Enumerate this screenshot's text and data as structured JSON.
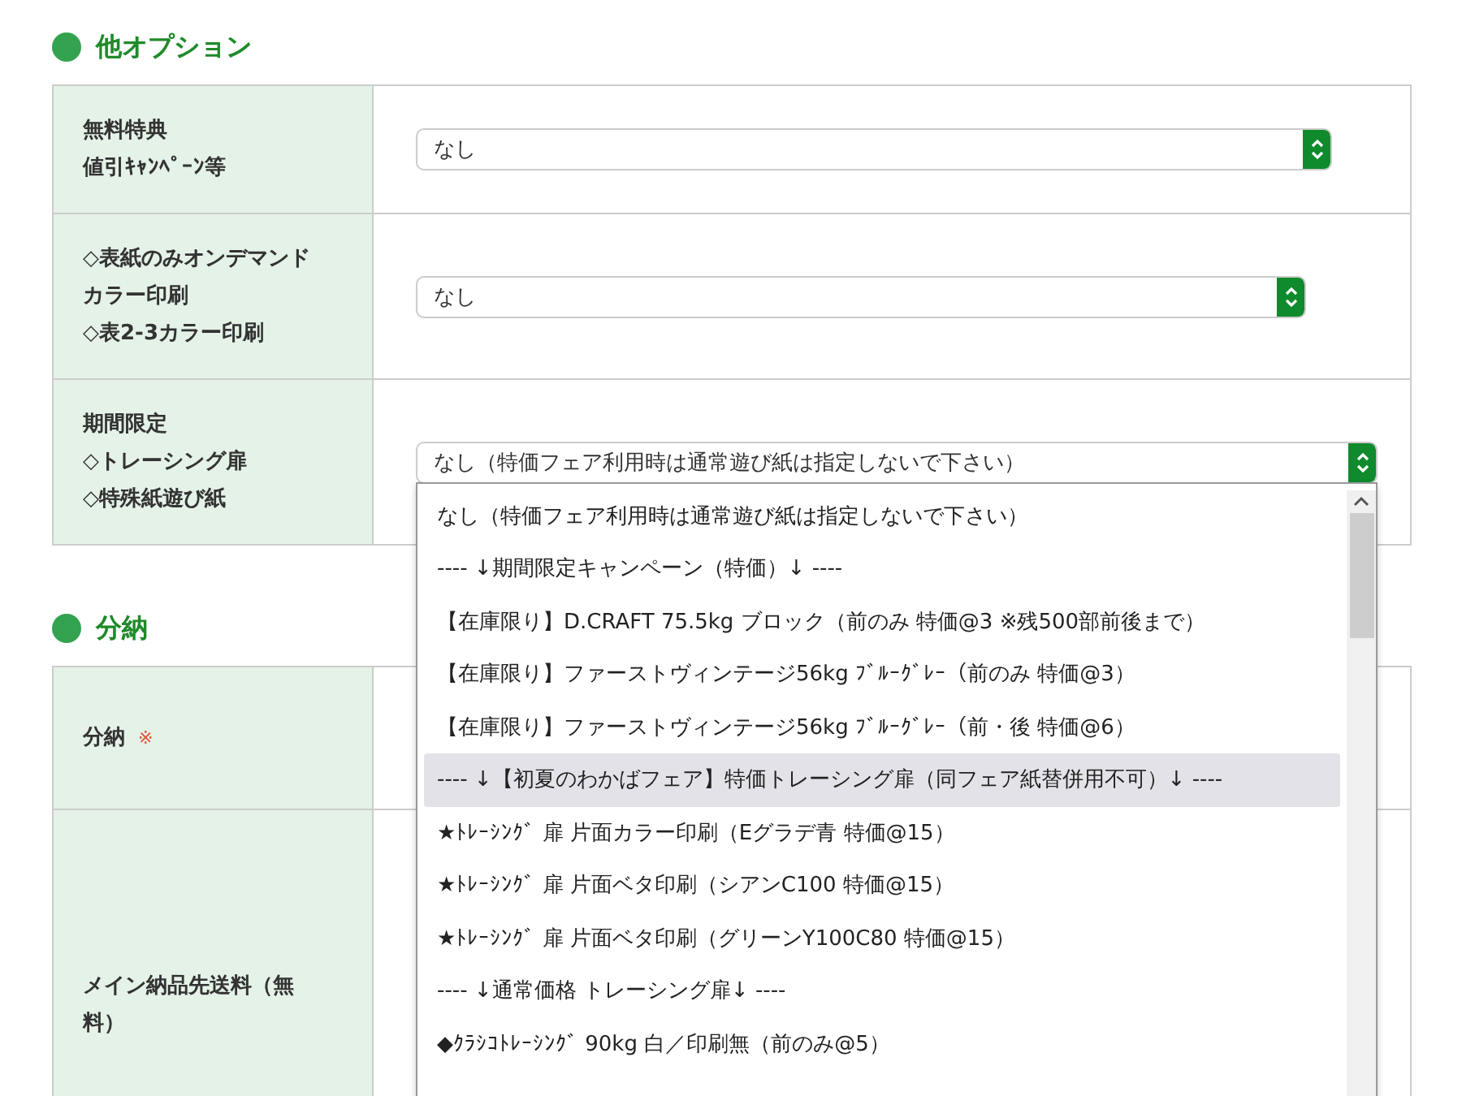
{
  "sections": [
    {
      "title": "他オプション",
      "rows": [
        {
          "label_lines": [
            "無料特典",
            "値引ｷｬﾝﾍﾟｰﾝ等"
          ],
          "select": {
            "value": "なし"
          }
        },
        {
          "label_lines": [
            "◇表紙のみオンデマンド",
            "カラー印刷",
            "◇表2-3カラー印刷"
          ],
          "select": {
            "value": "なし"
          }
        },
        {
          "label_lines": [
            "期間限定",
            "◇トレーシング扉",
            "◇特殊紙遊び紙"
          ],
          "select": {
            "value": "なし（特価フェア利用時は通常遊び紙は指定しないで下さい）",
            "expanded": true,
            "options": [
              {
                "label": "なし（特価フェア利用時は通常遊び紙は指定しないで下さい）",
                "highlighted": false
              },
              {
                "label": "---- ↓期間限定キャンペーン（特価）↓ ----",
                "highlighted": false
              },
              {
                "label": "【在庫限り】D.CRAFT 75.5kg ブロック（前のみ 特価@3 ※残500部前後まで）",
                "highlighted": false
              },
              {
                "label": "【在庫限り】ファーストヴィンテージ56kg ﾌﾞﾙｰｸﾞﾚｰ（前のみ 特価@3）",
                "highlighted": false
              },
              {
                "label": "【在庫限り】ファーストヴィンテージ56kg ﾌﾞﾙｰｸﾞﾚｰ（前・後 特価@6）",
                "highlighted": false
              },
              {
                "label": "---- ↓【初夏のわかばフェア】特価トレーシング扉（同フェア紙替併用不可）↓ ----",
                "highlighted": true
              },
              {
                "label": "★ﾄﾚｰｼﾝｸﾞ 扉 片面カラー印刷（Eグラデ青 特価@15）",
                "highlighted": false
              },
              {
                "label": "★ﾄﾚｰｼﾝｸﾞ 扉 片面ベタ印刷（シアンC100 特価@15）",
                "highlighted": false
              },
              {
                "label": "★ﾄﾚｰｼﾝｸﾞ 扉 片面ベタ印刷（グリーンY100C80 特価@15）",
                "highlighted": false
              },
              {
                "label": "---- ↓通常価格 トレーシング扉↓ ----",
                "highlighted": false
              },
              {
                "label": "◆ｸﾗｼｺﾄﾚｰｼﾝｸﾞ 90kg 白／印刷無（前のみ@5）",
                "highlighted": false
              }
            ]
          }
        }
      ]
    },
    {
      "title": "分納",
      "rows": [
        {
          "label_lines": [
            "分納"
          ],
          "required_mark": "※"
        },
        {
          "label_lines": [
            "メイン納品先送料（無",
            "料）"
          ]
        }
      ]
    }
  ]
}
